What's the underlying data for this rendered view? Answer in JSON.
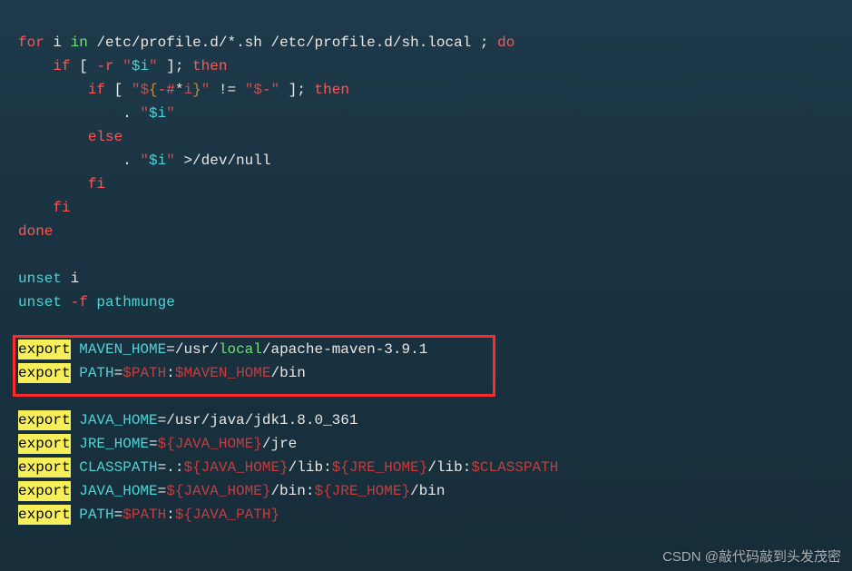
{
  "line1": {
    "for": "for",
    "i": "i",
    "in": "in",
    "paths": " /etc/profile.d/*.sh /etc/profile.d/sh.local ",
    "semi": ";",
    "do": "do"
  },
  "line2": {
    "if": "if",
    "lb": " [ ",
    "flag": "-r",
    "sp": " ",
    "q1": "\"",
    "var": "$i",
    "q2": "\"",
    "rb": " ]; ",
    "then": "then"
  },
  "line3": {
    "if": "if",
    "lb": " [ ",
    "q1": "\"",
    "d1": "$",
    "brace1": "{",
    "flag": "-#",
    "star": "*",
    "i": "i",
    "brace2": "}",
    "q2": "\"",
    "neq": " != ",
    "q3": "\"",
    "d2": "$",
    "dash": "-",
    "q4": "\"",
    "rb": " ]; ",
    "then": "then"
  },
  "line4": {
    "dot": ". ",
    "q1": "\"",
    "var": "$i",
    "q2": "\""
  },
  "line5": {
    "else": "else"
  },
  "line6": {
    "dot": ". ",
    "q1": "\"",
    "var": "$i",
    "q2": "\"",
    "gt": " >",
    "path": "/dev/null"
  },
  "line7": {
    "fi": "fi"
  },
  "line8": {
    "fi": "fi"
  },
  "line9": {
    "done": "done"
  },
  "line10": {
    "unset": "unset",
    "i": " i"
  },
  "line11": {
    "unset": "unset",
    "flag": " -f",
    "fn": " pathmunge"
  },
  "line12": {
    "export": "export",
    "k": " MAVEN_HOME",
    "eq": "=",
    "p1": "/usr/",
    "local": "local",
    "p2": "/apache-maven-3.9.1"
  },
  "line13": {
    "export": "export",
    "k": " PATH",
    "eq": "=",
    "v1": "$PATH",
    "colon": ":",
    "v2": "$MAVEN_HOME",
    "p": "/bin"
  },
  "line14": {
    "export": "export",
    "k": " JAVA_HOME",
    "eq": "=",
    "p": "/usr/java/jdk1.8.0_361"
  },
  "line15": {
    "export": "export",
    "k": " JRE_HOME",
    "eq": "=",
    "v": "${JAVA_HOME}",
    "p": "/jre"
  },
  "line16": {
    "export": "export",
    "k": " CLASSPATH",
    "eq": "=",
    "dot": ".",
    "c1": ":",
    "v1": "${JAVA_HOME}",
    "p1": "/lib",
    "c2": ":",
    "v2": "${JRE_HOME}",
    "p2": "/lib",
    "c3": ":",
    "v3": "$CLASSPATH"
  },
  "line17": {
    "export": "export",
    "k": " JAVA_HOME",
    "eq": "=",
    "v1": "${JAVA_HOME}",
    "p1": "/bin",
    "c1": ":",
    "v2": "${JRE_HOME}",
    "p2": "/bin"
  },
  "line18": {
    "export": "export",
    "k": " PATH",
    "eq": "=",
    "v1": "$PATH",
    "c1": ":",
    "v2": "${JAVA_PATH}"
  },
  "watermark": "CSDN @敲代码敲到头发茂密"
}
